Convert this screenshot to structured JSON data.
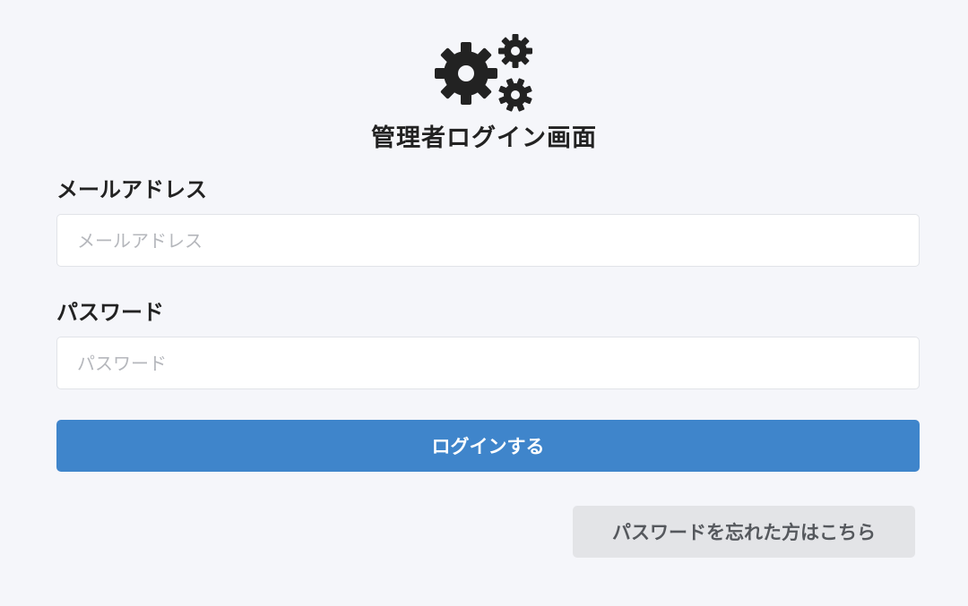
{
  "header": {
    "icon": "gears-icon",
    "title": "管理者ログイン画面"
  },
  "form": {
    "email": {
      "label": "メールアドレス",
      "placeholder": "メールアドレス",
      "value": ""
    },
    "password": {
      "label": "パスワード",
      "placeholder": "パスワード",
      "value": ""
    },
    "submit_label": "ログインする",
    "forgot_label": "パスワードを忘れた方はこちら"
  },
  "colors": {
    "background": "#f5f6fa",
    "primary": "#3f85cb",
    "secondary_button": "#e3e4e7",
    "text": "#222222"
  }
}
